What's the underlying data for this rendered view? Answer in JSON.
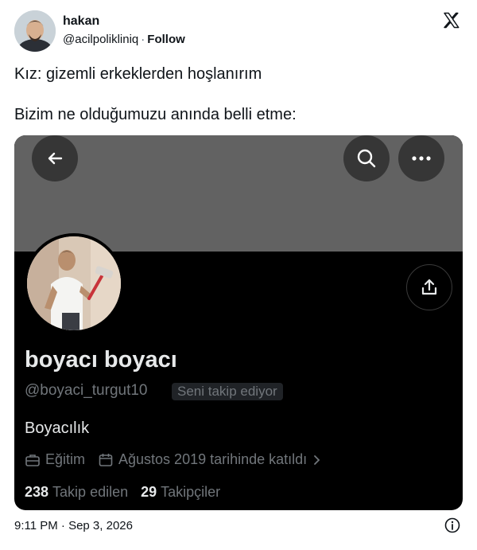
{
  "tweet": {
    "author_name": "hakan",
    "handle": "@acilpolikliniq",
    "separator": "·",
    "follow_label": "Follow",
    "text_line1": "Kız: gizemli erkeklerden hoşlanırım",
    "text_line2": "Bizim ne olduğumuzu anında belli etme:",
    "timestamp": "9:11 PM · Sep 3, 2026",
    "logo_icon": "x-logo-icon",
    "info_icon": "info-icon"
  },
  "profile": {
    "display_name": "boyacı boyacı",
    "handle": "@boyaci_turgut10",
    "follows_you_badge": "Seni takip ediyor",
    "bio": "Boyacılık",
    "category": "Eğitim",
    "joined": "Ağustos 2019 tarihinde katıldı",
    "following_count": "238",
    "following_label": "Takip edilen",
    "followers_count": "29",
    "followers_label": "Takipçiler",
    "icons": [
      "back-arrow-icon",
      "search-icon",
      "more-icon",
      "share-icon",
      "briefcase-icon",
      "calendar-icon",
      "chevron-right-icon"
    ]
  },
  "colors": {
    "banner": "#626262",
    "profile_bg": "#000000",
    "primary_text_dark": "#e7e9ea",
    "secondary_text_dark": "#71767b",
    "tweet_text": "#0f1419"
  }
}
